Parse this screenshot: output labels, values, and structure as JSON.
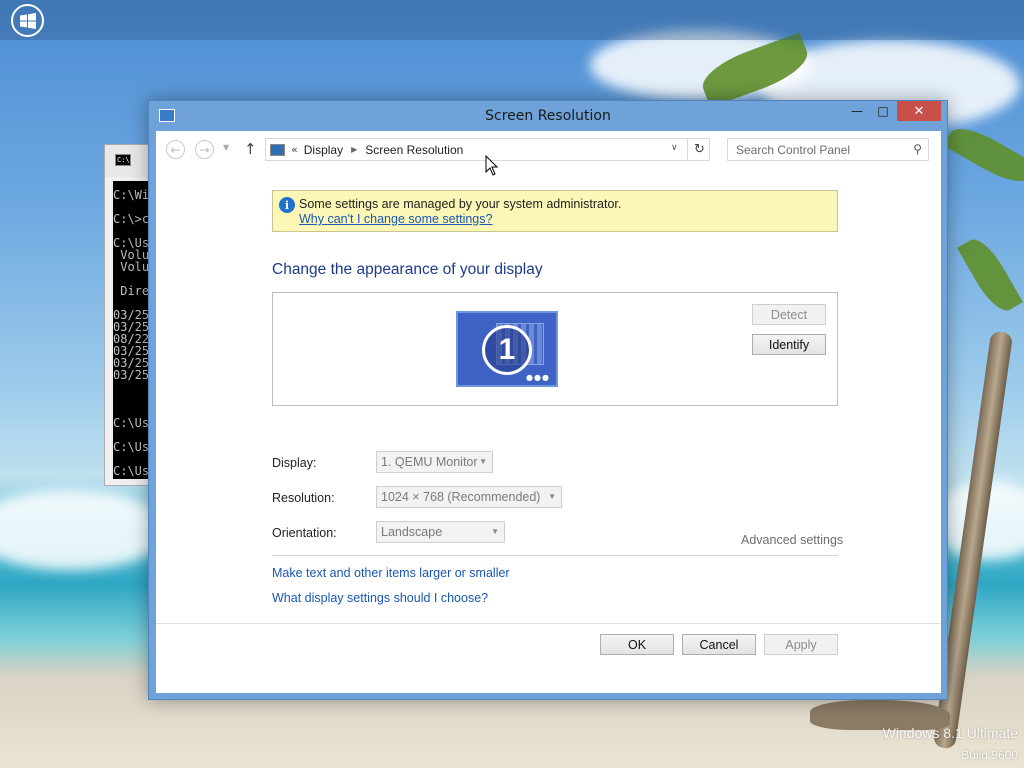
{
  "desktop": {
    "watermark_line1": "Windows 8.1 Ultimate",
    "watermark_line2": "Build 9600"
  },
  "cmd": {
    "icon_text": "C:\\.",
    "lines": "C:\\Wi\n\nC:\\>c\n\nC:\\Us\n Volu\n Volu\n\n Dire\n\n03/25\n03/25\n08/22\n03/25\n03/25\n03/25\n\n\n\nC:\\Us\n\nC:\\Us\n\nC:\\Us"
  },
  "window": {
    "title": "Screen Resolution",
    "minimize_glyph": "—",
    "maximize_glyph": "□",
    "close_glyph": "✕"
  },
  "nav": {
    "back_glyph": "←",
    "forward_glyph": "→",
    "up_glyph": "↑",
    "breadcrumb_prefix": "«",
    "breadcrumbs": [
      "Display",
      "Screen Resolution"
    ],
    "refresh_glyph": "↻",
    "search_placeholder": "Search Control Panel"
  },
  "info": {
    "message": "Some settings are managed by your system administrator.",
    "link": "Why can't I change some settings?"
  },
  "main": {
    "heading": "Change the appearance of your display",
    "monitor_number": "1",
    "detect_label": "Detect",
    "identify_label": "Identify",
    "display_label": "Display:",
    "display_value": "1. QEMU Monitor",
    "resolution_label": "Resolution:",
    "resolution_value": "1024 × 768 (Recommended)",
    "orientation_label": "Orientation:",
    "orientation_value": "Landscape",
    "advanced_link": "Advanced settings",
    "link_text_size": "Make text and other items larger or smaller",
    "link_display_help": "What display settings should I choose?"
  },
  "footer": {
    "ok_label": "OK",
    "cancel_label": "Cancel",
    "apply_label": "Apply"
  }
}
